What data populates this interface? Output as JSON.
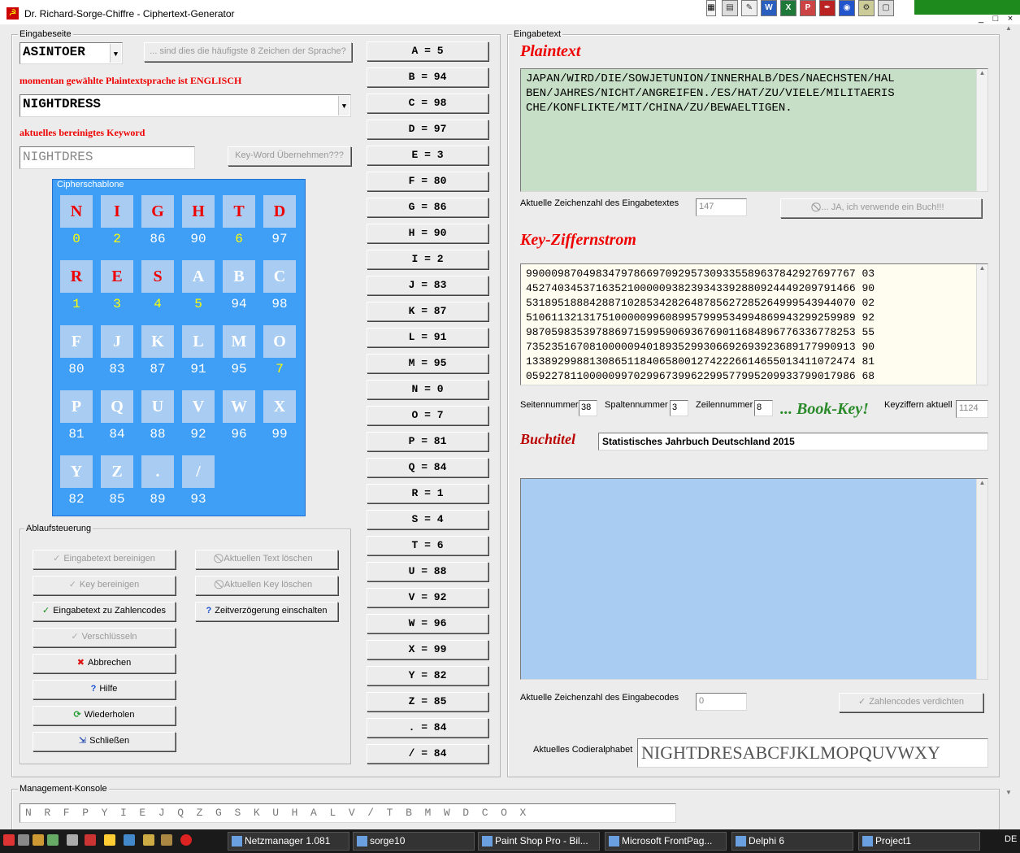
{
  "window": {
    "title": "Dr. Richard-Sorge-Chiffre - Ciphertext-Generator",
    "app_icon": "hammer-sickle-icon"
  },
  "toolbar_icons": [
    "notepad-icon",
    "editor-icon",
    "word-icon",
    "excel-icon",
    "powerpoint-icon",
    "pen-icon",
    "network-icon",
    "settings-icon",
    "file-icon"
  ],
  "left": {
    "group_label": "Eingabeseite",
    "language_combo": "ASINTOER",
    "frequent_button": "... sind dies die häufigste 8 Zeichen der Sprache?",
    "language_info": "momentan gewählte Plaintextsprache ist ENGLISCH",
    "keyword_combo": "NIGHTDRESS",
    "cleaned_keyword_label": "aktuelles bereinigtes Keyword",
    "cleaned_keyword_value": "NIGHTDRES",
    "take_keyword_button": "Key-Word Übernehmen???"
  },
  "cipher": {
    "label": "Cipherschablone",
    "rows": [
      [
        {
          "c": "N",
          "n": "0",
          "red": true,
          "y": true
        },
        {
          "c": "I",
          "n": "2",
          "red": true,
          "y": true
        },
        {
          "c": "G",
          "n": "86",
          "red": true,
          "y": false
        },
        {
          "c": "H",
          "n": "90",
          "red": true,
          "y": false
        },
        {
          "c": "T",
          "n": "6",
          "red": true,
          "y": true
        },
        {
          "c": "D",
          "n": "97",
          "red": true,
          "y": false
        }
      ],
      [
        {
          "c": "R",
          "n": "1",
          "red": true,
          "y": true
        },
        {
          "c": "E",
          "n": "3",
          "red": true,
          "y": true
        },
        {
          "c": "S",
          "n": "4",
          "red": true,
          "y": true
        },
        {
          "c": "A",
          "n": "5",
          "red": false,
          "y": true
        },
        {
          "c": "B",
          "n": "94",
          "red": false,
          "y": false
        },
        {
          "c": "C",
          "n": "98",
          "red": false,
          "y": false
        }
      ],
      [
        {
          "c": "F",
          "n": "80",
          "red": false,
          "y": false
        },
        {
          "c": "J",
          "n": "83",
          "red": false,
          "y": false
        },
        {
          "c": "K",
          "n": "87",
          "red": false,
          "y": false
        },
        {
          "c": "L",
          "n": "91",
          "red": false,
          "y": false
        },
        {
          "c": "M",
          "n": "95",
          "red": false,
          "y": false
        },
        {
          "c": "O",
          "n": "7",
          "red": false,
          "y": true
        }
      ],
      [
        {
          "c": "P",
          "n": "81",
          "red": false,
          "y": false
        },
        {
          "c": "Q",
          "n": "84",
          "red": false,
          "y": false
        },
        {
          "c": "U",
          "n": "88",
          "red": false,
          "y": false
        },
        {
          "c": "V",
          "n": "92",
          "red": false,
          "y": false
        },
        {
          "c": "W",
          "n": "96",
          "red": false,
          "y": false
        },
        {
          "c": "X",
          "n": "99",
          "red": false,
          "y": false
        }
      ],
      [
        {
          "c": "Y",
          "n": "82",
          "red": false,
          "y": false
        },
        {
          "c": "Z",
          "n": "85",
          "red": false,
          "y": false
        },
        {
          "c": ".",
          "n": "89",
          "red": false,
          "y": false
        },
        {
          "c": "/",
          "n": "93",
          "red": false,
          "y": false
        }
      ]
    ]
  },
  "control": {
    "group_label": "Ablaufsteuerung",
    "buttons": [
      {
        "label": "Eingabetext bereinigen",
        "icon": "check-icon",
        "enabled": false
      },
      {
        "label": "Aktuellen Text löschen",
        "icon": "forbidden-icon",
        "enabled": false
      },
      {
        "label": "Key bereinigen",
        "icon": "check-icon",
        "enabled": false
      },
      {
        "label": "Aktuellen Key löschen",
        "icon": "forbidden-icon",
        "enabled": false
      },
      {
        "label": "Eingabetext zu Zahlencodes",
        "icon": "check-icon",
        "enabled": true
      },
      {
        "label": "Zeitverzögerung einschalten",
        "icon": "help-icon",
        "enabled": true
      },
      {
        "label": "Verschlüsseln",
        "icon": "check-icon",
        "enabled": false
      },
      {
        "label": "Abbrechen",
        "icon": "cancel-icon",
        "enabled": true
      },
      {
        "label": "Hilfe",
        "icon": "help-icon",
        "enabled": true
      },
      {
        "label": "Wiederholen",
        "icon": "refresh-icon",
        "enabled": true
      },
      {
        "label": "Schließen",
        "icon": "exit-icon",
        "enabled": true
      }
    ]
  },
  "mapping": [
    "A = 5",
    "B = 94",
    "C = 98",
    "D = 97",
    "E = 3",
    "F = 80",
    "G = 86",
    "H = 90",
    "I = 2",
    "J = 83",
    "K = 87",
    "L = 91",
    "M = 95",
    "N = 0",
    "O = 7",
    "P = 81",
    "Q = 84",
    "R = 1",
    "S = 4",
    "T = 6",
    "U = 88",
    "V = 92",
    "W = 96",
    "X = 99",
    "Y = 82",
    "Z = 85",
    ". = 84",
    "/ = 84"
  ],
  "right": {
    "group_label": "Eingabetext",
    "plaintext_label": "Plaintext",
    "plaintext": "JAPAN/WIRD/DIE/SOWJETUNION/INNERHALB/DES/NAECHSTEN/HAL\nBEN/JAHRES/NICHT/ANGREIFEN./ES/HAT/ZU/VIELE/MILITAERIS\nCHE/KONFLIKTE/MIT/CHINA/ZU/BEWAELTIGEN.",
    "char_count_label": "Aktuelle Zeichenzahl des Eingabetextes",
    "char_count": "147",
    "book_button": "... JA, ich verwende ein Buch!!!",
    "keystream_label": "Key-Ziffernstrom",
    "keystream": "9900098704983479786697092957309335589637842927697767 03\n4527403453716352100000938239343392880924449209791466 90\n5318951888428871028534282648785627285264999543944070 02\n5106113213175100000996089957999534994869943299259989 92\n9870598353978869715995906936769011684896776336778253 55\n7352351670810000094018935299306692693923689177990913 90\n1338929988130865118406580012742226614655013411072474 81\n0592278110000099702996739962299577995209933799017986 68",
    "page_label": "Seitennummer",
    "page_value": "38",
    "col_label": "Spaltennummer",
    "col_value": "3",
    "row_label": "Zeilennummer",
    "row_value": "8",
    "book_key_label": "... Book-Key!",
    "keydigits_label": "Keyziffern aktuell",
    "keydigits_value": "1124",
    "book_title_label": "Buchtitel",
    "book_title": "Statistisches Jahrbuch Deutschland 2015",
    "codes_count_label": "Aktuelle Zeichenzahl des Eingabecodes",
    "codes_count": "0",
    "condense_button": "Zahlencodes verdichten",
    "alphabet_label": "Aktuelles Codieralphabet",
    "alphabet": "NIGHTDRESABCFJKLMOPQUVWXY"
  },
  "management": {
    "group_label": "Management-Konsole",
    "sequence": "N  R  F  P  Y  I  E  J  Q  Z  G  S  K  U  H  A  L  V  /  T  B  M  W  D  C  O  X"
  },
  "taskbar": {
    "tasks": [
      {
        "label": "Netzmanager 1.081",
        "icon": "network-icon"
      },
      {
        "label": "sorge10",
        "icon": "folder-icon"
      },
      {
        "label": "Paint Shop Pro - Bil...",
        "icon": "paint-icon"
      },
      {
        "label": "Microsoft FrontPag...",
        "icon": "frontpage-icon"
      },
      {
        "label": "Delphi 6",
        "icon": "delphi-icon"
      },
      {
        "label": "Project1",
        "icon": "project-icon"
      }
    ],
    "locale": "DE"
  }
}
